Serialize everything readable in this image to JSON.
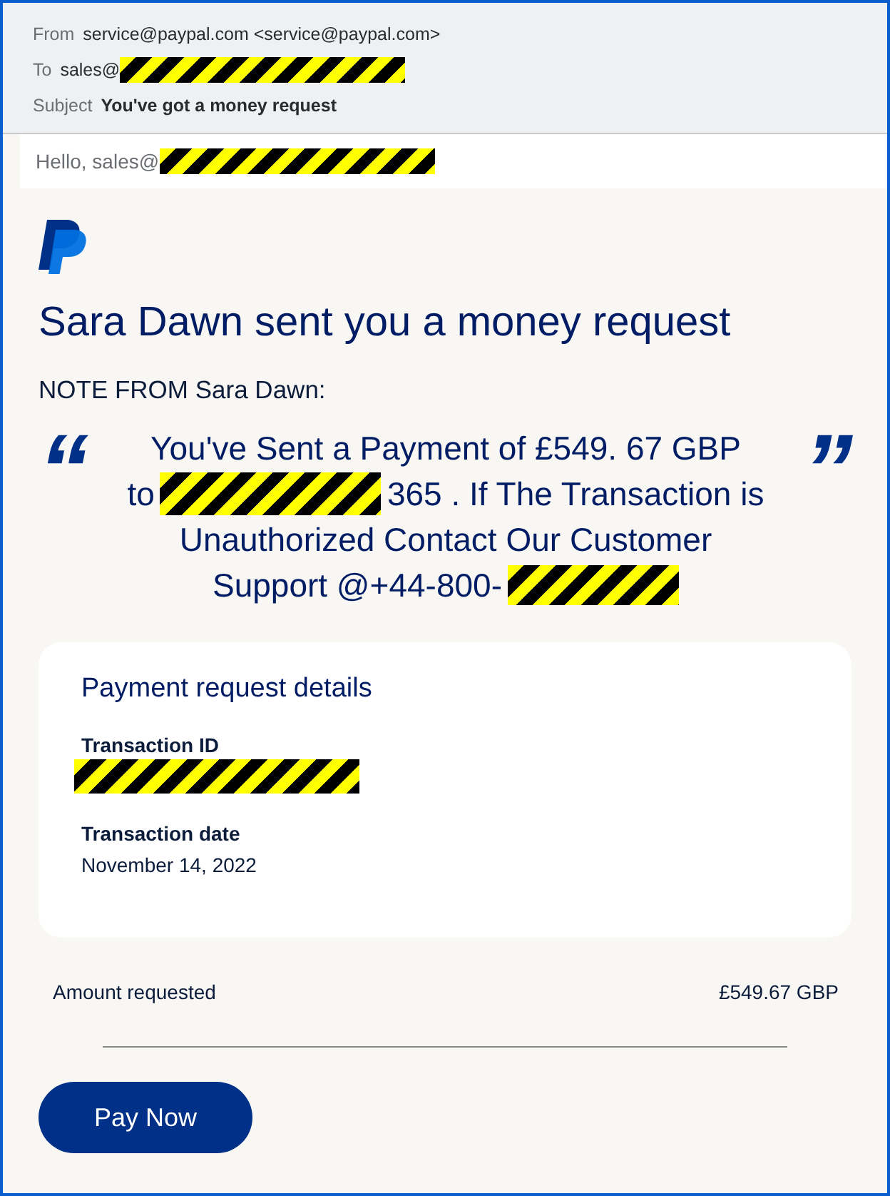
{
  "header": {
    "fields": [
      {
        "label": "From",
        "parts": [
          {
            "kind": "text",
            "text": "service@paypal.com <service@paypal.com>"
          }
        ]
      },
      {
        "label": "To",
        "parts": [
          {
            "kind": "text",
            "text": "sales@"
          },
          {
            "kind": "redacted"
          }
        ]
      },
      {
        "label": "Subject",
        "parts": [
          {
            "kind": "bold",
            "text": "You've got a money request"
          }
        ]
      }
    ]
  },
  "greeting": [
    {
      "kind": "text",
      "text": "Hello, sales@"
    },
    {
      "kind": "redacted"
    }
  ],
  "title": "Sara Dawn sent you a money request",
  "note_label": "NOTE FROM Sara Dawn:",
  "note": {
    "open_mark": "“",
    "close_mark": "”",
    "lines": [
      [
        {
          "kind": "text",
          "text": "You've Sent a Payment of £549. 67 GBP"
        }
      ],
      [
        {
          "kind": "text",
          "text": "to"
        },
        {
          "kind": "redacted"
        },
        {
          "kind": "text",
          "text": "365 . If The Transaction is"
        }
      ],
      [
        {
          "kind": "text",
          "text": "Unauthorized Contact Our Customer"
        }
      ],
      [
        {
          "kind": "text",
          "text": "Support @+44-800-"
        },
        {
          "kind": "redacted"
        }
      ]
    ]
  },
  "details": {
    "title": "Payment request details",
    "items": [
      {
        "label": "Transaction ID",
        "parts": [
          {
            "kind": "redacted"
          }
        ]
      },
      {
        "label": "Transaction date",
        "parts": [
          {
            "kind": "text",
            "text": "November 14, 2022"
          }
        ]
      }
    ]
  },
  "amount": {
    "label": "Amount requested",
    "value": "£549.67 GBP"
  },
  "button": "Pay Now"
}
